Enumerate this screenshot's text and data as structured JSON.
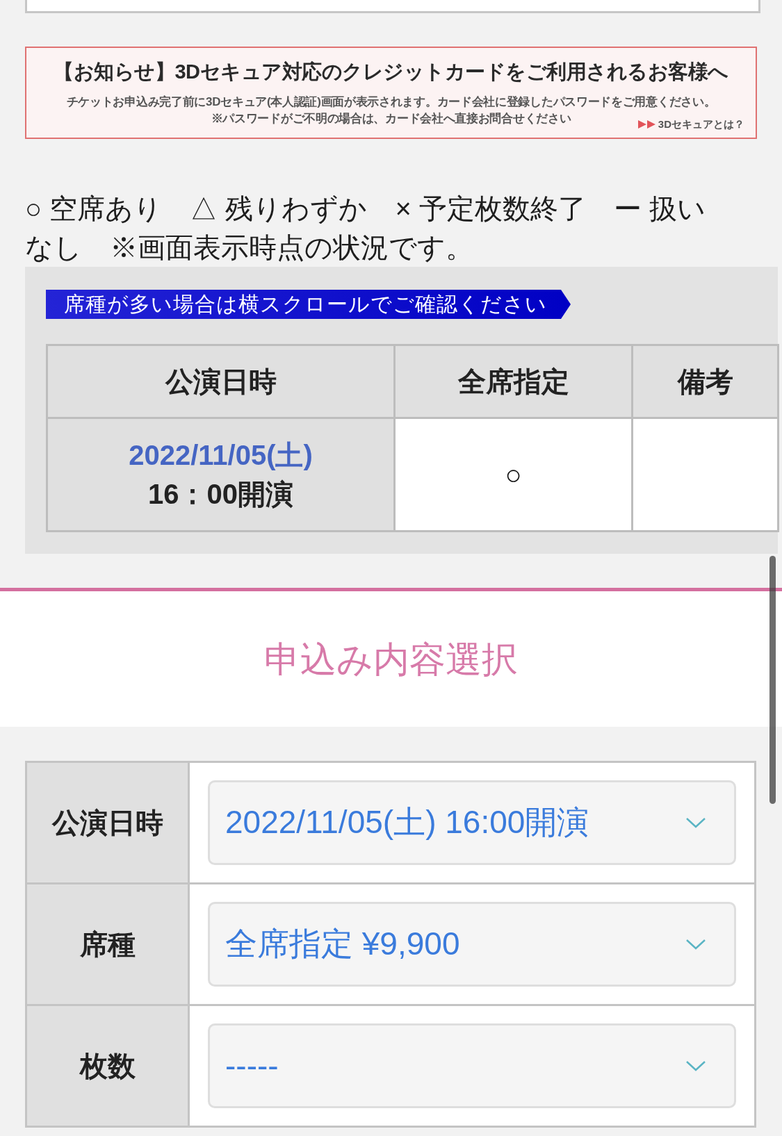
{
  "notice": {
    "title": "【お知らせ】3Dセキュア対応のクレジットカードをご利用されるお客様へ",
    "lines": [
      "チケットお申込み完了前に3Dセキュア(本人認証)画面が表示されます。カード会社に登録したパスワードをご用意ください。",
      "※パスワードがご不明の場合は、カード会社へ直接お問合せください"
    ],
    "link": "3Dセキュアとは？"
  },
  "legend": "○ 空席あり　△ 残りわずか　× 予定枚数終了　ー 扱いなし　※画面表示時点の状況です。",
  "availability": {
    "scroll_hint": "席種が多い場合は横スクロールでご確認ください",
    "columns": [
      "公演日時",
      "全席指定",
      "備考"
    ],
    "rows": [
      {
        "date": "2022/11/05(土)",
        "time": "16：00開演",
        "status": "○"
      }
    ]
  },
  "application": {
    "title": "申込み内容選択",
    "fields": [
      {
        "label": "公演日時",
        "value": "2022/11/05(土) 16:00開演"
      },
      {
        "label": "席種",
        "value": "全席指定 ¥9,900"
      },
      {
        "label": "枚数",
        "value": "-----"
      }
    ]
  }
}
